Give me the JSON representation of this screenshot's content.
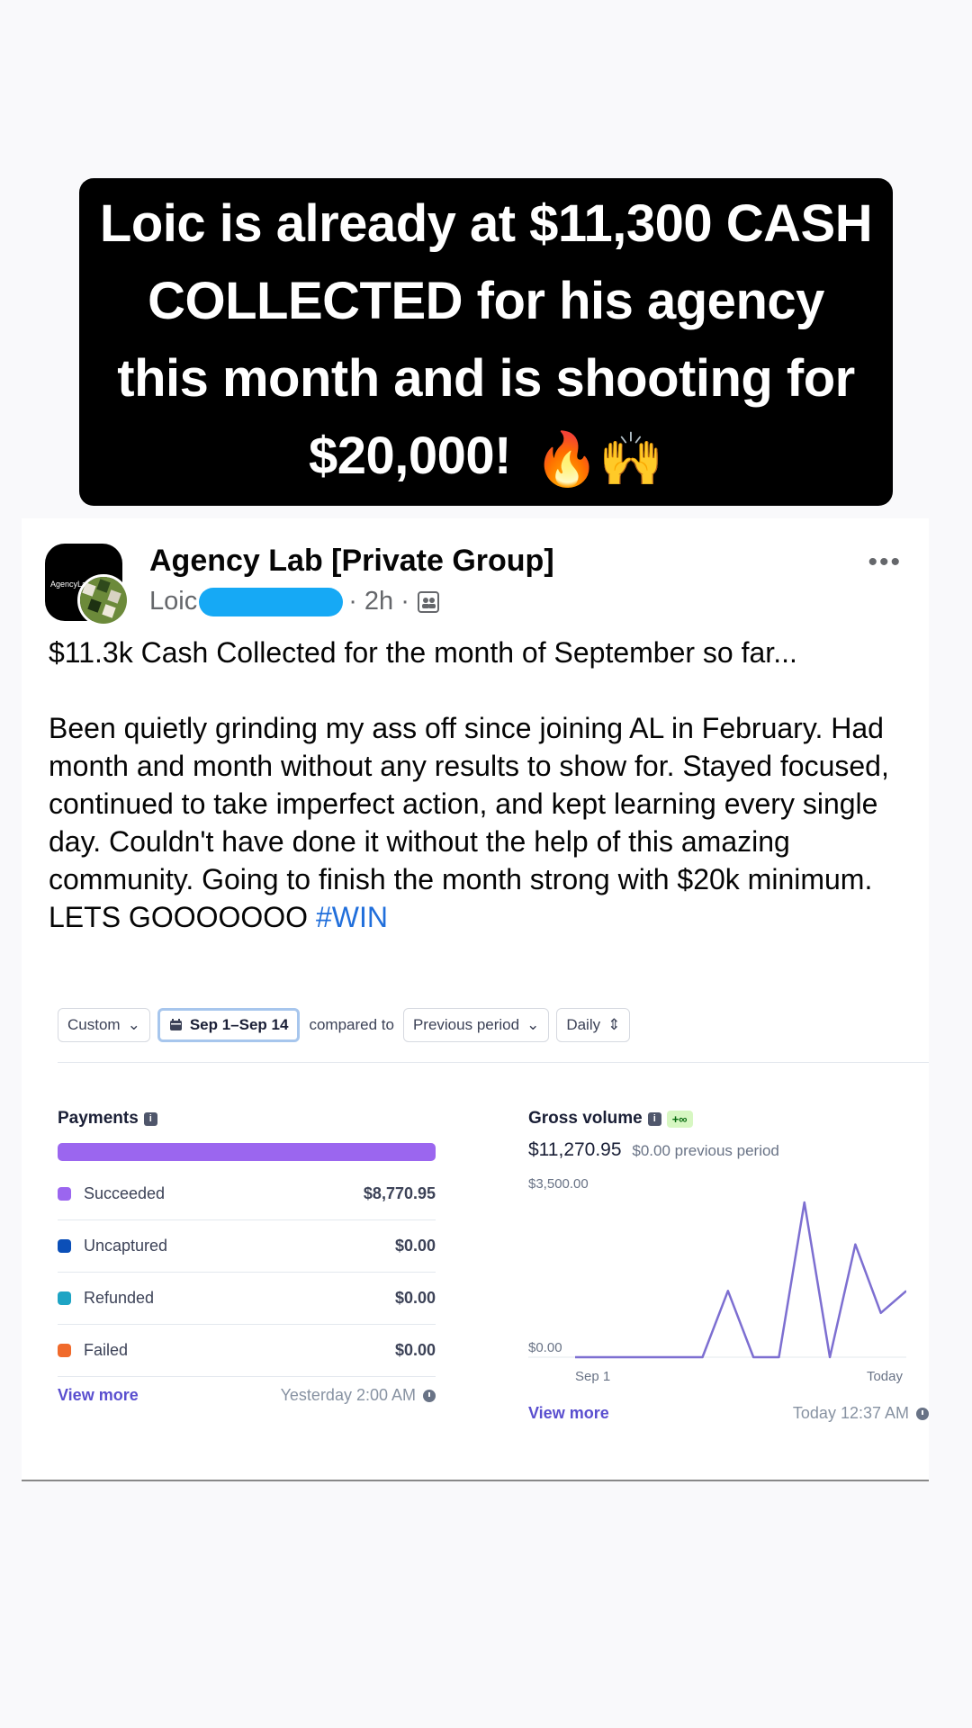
{
  "headline": {
    "text": "Loic is already at $11,300 CASH COLLECTED for his agency this month and is shooting for $20,000!",
    "emojis": "🔥🙌"
  },
  "post": {
    "group_name": "Agency Lab [Private Group]",
    "group_avatar_text": "AgencyLab",
    "author": "Loic",
    "time": "· 2h ·",
    "more_icon": "•••",
    "text": "$11.3k Cash Collected for the month of September so far...\n\nBeen quietly grinding my ass off since joining AL in February. Had month and month without any results to show for. Stayed focused, continued to take imperfect action, and kept learning every single day. Couldn't have done it without the help of this amazing community. Going to finish the month strong with $20k minimum. LETS GOOOOOOO ",
    "hashtag": "#WIN"
  },
  "dashboard": {
    "filters": {
      "range_type": "Custom",
      "date_range": "Sep 1–Sep 14",
      "compared_label": "compared to",
      "comparison": "Previous period",
      "interval": "Daily"
    },
    "payments": {
      "title": "Payments",
      "bar_color": "#9b66ef",
      "rows": [
        {
          "label": "Succeeded",
          "value": "$8,770.95",
          "color": "#9b66ef"
        },
        {
          "label": "Uncaptured",
          "value": "$0.00",
          "color": "#0b4fb8"
        },
        {
          "label": "Refunded",
          "value": "$0.00",
          "color": "#1ea4c4"
        },
        {
          "label": "Failed",
          "value": "$0.00",
          "color": "#f06a2b"
        }
      ],
      "view_more": "View more",
      "updated": "Yesterday 2:00 AM"
    },
    "gross": {
      "title": "Gross volume",
      "badge": "+∞",
      "value": "$11,270.95",
      "previous": "$0.00 previous period",
      "view_more": "View more",
      "updated": "Today 12:37 AM"
    }
  },
  "chart_data": {
    "type": "line",
    "title": "Gross volume",
    "y_tick_labels": [
      "$3,500.00",
      "$0.00"
    ],
    "x_tick_labels": [
      "Sep 1",
      "Today"
    ],
    "ylim": [
      0,
      3500
    ],
    "x": [
      1,
      2,
      3,
      4,
      5,
      6,
      7,
      8,
      9,
      10,
      11,
      12,
      13,
      14
    ],
    "series": [
      {
        "color": "#7d6fd1",
        "values": [
          0,
          0,
          0,
          0,
          0,
          0,
          1500,
          0,
          0,
          3500,
          0,
          2550,
          1000,
          1500
        ]
      }
    ]
  }
}
